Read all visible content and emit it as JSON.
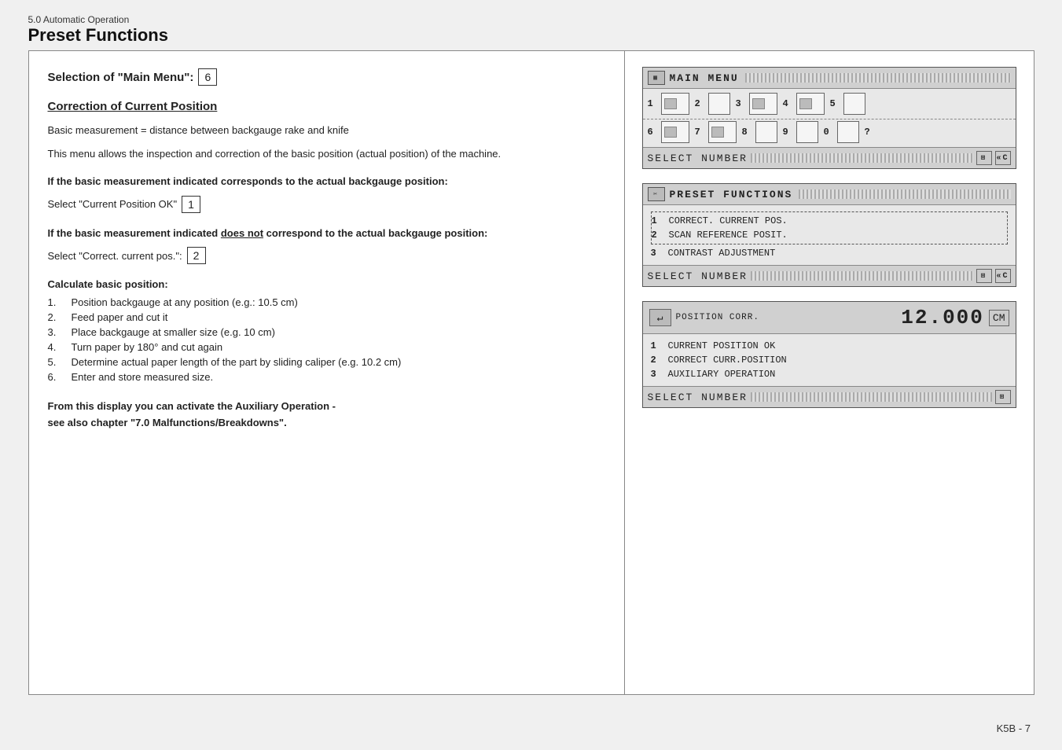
{
  "header": {
    "section": "5.0 Automatic Operation",
    "title": "Preset Functions"
  },
  "left": {
    "main_menu_label": "Selection of \"Main Menu\":",
    "main_menu_number": "6",
    "section_title": "Correction of Current Position",
    "desc1": "Basic measurement = distance between backgauge rake and knife",
    "desc2": "This menu allows the inspection and correction of the basic position (actual position) of the machine.",
    "if_ok_label": "If the basic measurement indicated corresponds to the actual backgauge position:",
    "select_ok_label": "Select \"Current Position OK\"",
    "select_ok_number": "1",
    "if_not_ok_label": "If the basic measurement indicated does not correspond to the actual backgauge position:",
    "select_correct_label": "Select \"Correct. current pos.\":",
    "select_correct_number": "2",
    "calculate_label": "Calculate basic position:",
    "steps": [
      {
        "num": "1.",
        "text": "Position backgauge at any position (e.g.: 10.5 cm)"
      },
      {
        "num": "2.",
        "text": "Feed paper and cut it"
      },
      {
        "num": "3.",
        "text": "Place backgauge at smaller size (e.g. 10 cm)"
      },
      {
        "num": "4.",
        "text": "Turn paper by 180° and cut again"
      },
      {
        "num": "5.",
        "text": "Determine actual paper length of the part by sliding caliper (e.g. 10.2 cm)"
      },
      {
        "num": "6.",
        "text": "Enter and store measured size."
      }
    ],
    "auxiliary_note": "From this display you can activate the Auxiliary Operation -\nsee also chapter \"7.0 Malfunctions/Breakdowns\"."
  },
  "right": {
    "screen1": {
      "title": "MAIN  MENU",
      "row1": [
        {
          "num": "1",
          "icon": true
        },
        {
          "num": "2",
          "icon": false
        },
        {
          "num": "3",
          "icon": true
        },
        {
          "num": "4",
          "icon": true
        },
        {
          "num": "5",
          "icon": false
        }
      ],
      "row2": [
        {
          "num": "6",
          "icon": true
        },
        {
          "num": "7",
          "icon": true
        },
        {
          "num": "8",
          "icon": false
        },
        {
          "num": "9",
          "icon": false
        },
        {
          "num": "0",
          "icon": false
        },
        {
          "num": "?",
          "icon": false
        }
      ],
      "select_label": "SELECT  NUMBER"
    },
    "screen2": {
      "title": "PRESET  FUNCTIONS",
      "items": [
        {
          "num": "1",
          "text": "CORRECT. CURRENT POS.",
          "dashed": true
        },
        {
          "num": "2",
          "text": "SCAN REFERENCE POSIT.",
          "dashed": true
        },
        {
          "num": "3",
          "text": "CONTRAST ADJUSTMENT",
          "dashed": false
        }
      ],
      "select_label": "SELECT  NUMBER"
    },
    "screen3": {
      "pos_icon": "↵",
      "pos_label": "POSITION CORR.",
      "pos_value": "12.000",
      "pos_unit": "CM",
      "items": [
        {
          "num": "1",
          "text": "CURRENT POSITION OK"
        },
        {
          "num": "2",
          "text": "CORRECT CURR.POSITION"
        },
        {
          "num": "3",
          "text": "AUXILIARY OPERATION"
        }
      ],
      "select_label": "SELECT  NUMBER"
    }
  },
  "page_number": "K5B - 7"
}
